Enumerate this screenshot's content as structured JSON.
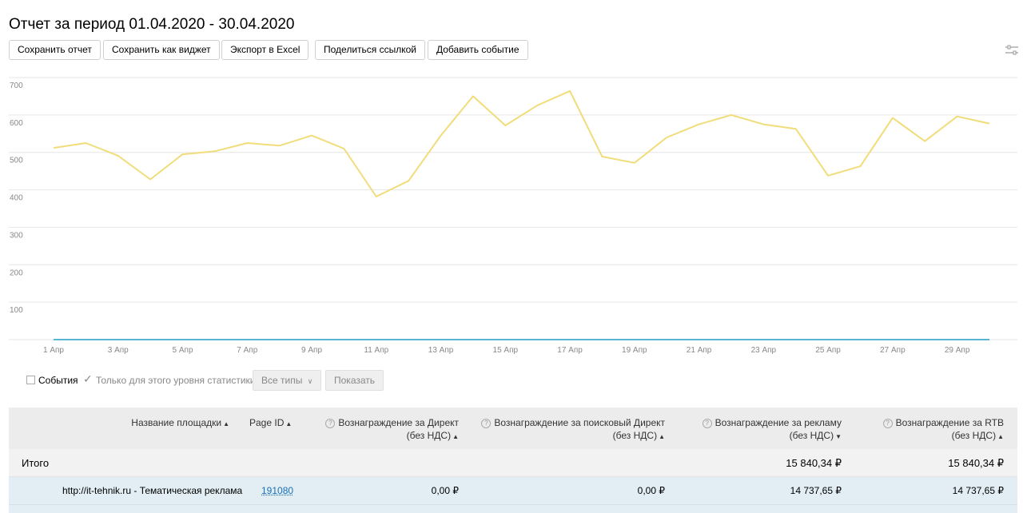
{
  "header": {
    "title": "Отчет за период 01.04.2020 - 30.04.2020"
  },
  "toolbar": {
    "save_report": "Сохранить отчет",
    "save_widget": "Сохранить как виджет",
    "export_excel": "Экспорт в Excel",
    "share_link": "Поделиться ссылкой",
    "add_event": "Добавить событие",
    "settings_icon": "settings-sliders-icon"
  },
  "chart_data": {
    "type": "line",
    "x": [
      "1 Апр",
      "2 Апр",
      "3 Апр",
      "4 Апр",
      "5 Апр",
      "6 Апр",
      "7 Апр",
      "8 Апр",
      "9 Апр",
      "10 Апр",
      "11 Апр",
      "12 Апр",
      "13 Апр",
      "14 Апр",
      "15 Апр",
      "16 Апр",
      "17 Апр",
      "18 Апр",
      "19 Апр",
      "20 Апр",
      "21 Апр",
      "22 Апр",
      "23 Апр",
      "24 Апр",
      "25 Апр",
      "26 Апр",
      "27 Апр",
      "28 Апр",
      "29 Апр",
      "30 Апр"
    ],
    "x_tick_labels": [
      "1 Апр",
      "3 Апр",
      "5 Апр",
      "7 Апр",
      "9 Апр",
      "11 Апр",
      "13 Апр",
      "15 Апр",
      "17 Апр",
      "19 Апр",
      "21 Апр",
      "23 Апр",
      "25 Апр",
      "27 Апр",
      "29 Апр"
    ],
    "series": [
      {
        "color": "#f0dd7a",
        "values": [
          512,
          525,
          491,
          428,
          495,
          503,
          525,
          518,
          545,
          510,
          382,
          424,
          545,
          650,
          572,
          626,
          664,
          489,
          472,
          540,
          575,
          600,
          575,
          563,
          438,
          463,
          592,
          530,
          596,
          577
        ]
      },
      {
        "color": "#5ab4d6",
        "values": [
          0,
          0,
          0,
          0,
          0,
          0,
          0,
          0,
          0,
          0,
          0,
          0,
          0,
          0,
          0,
          0,
          0,
          0,
          0,
          0,
          0,
          0,
          0,
          0,
          0,
          0,
          0,
          0,
          0,
          0
        ]
      }
    ],
    "y_ticks": [
      "100",
      "200",
      "300",
      "400",
      "500",
      "600",
      "700"
    ],
    "ylim": [
      0,
      700
    ],
    "grid": true
  },
  "controls": {
    "events_label": "События",
    "events_checked": false,
    "level_only_label": "Только для этого уровня статистики",
    "level_only_checked": true,
    "all_types": "Все типы",
    "show": "Показать"
  },
  "table": {
    "columns": {
      "site_name": "Название площадки",
      "page_id": "Page ID",
      "direct_line1": "Вознаграждение за Директ",
      "direct_line2": "(без НДС)",
      "search_direct_line1": "Вознаграждение за поисковый Директ",
      "search_direct_line2": "(без НДС)",
      "ads_line1": "Вознаграждение за рекламу",
      "ads_line2": "(без НДС)",
      "rtb_line1": "Вознаграждение за RTB",
      "rtb_line2": "(без НДС)"
    },
    "total": {
      "label": "Итого",
      "ads": "15 840,34 ₽",
      "rtb": "15 840,34 ₽"
    },
    "rows": [
      {
        "site": "http://it-tehnik.ru - Тематическая реклама",
        "page_id": "191080",
        "direct": "0,00 ₽",
        "search_direct": "0,00 ₽",
        "ads": "14 737,65 ₽",
        "rtb": "14 737,65 ₽"
      }
    ]
  }
}
